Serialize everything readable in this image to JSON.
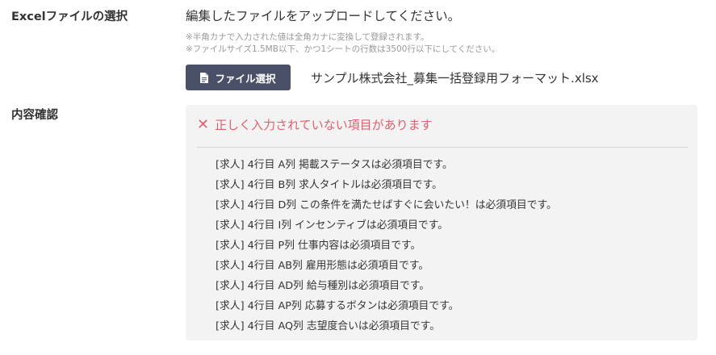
{
  "form": {
    "excel_label": "Excelファイルの選択",
    "instruction": "編集したファイルをアップロードしてください。",
    "note_1": "※半角カナで入力された値は全角カナに変換して登録されます。",
    "note_2": "※ファイルサイズ1.5MB以下、かつ1シートの行数は3500行以下にしてください。",
    "select_button_label": "ファイル選択",
    "select_button_icon": "document-icon",
    "file_name": "サンプル株式会社_募集一括登録用フォーマット.xlsx",
    "confirm_label": "内容確認"
  },
  "errors": {
    "header": "正しく入力されていない項目があります",
    "header_icon": "close-icon",
    "accent_color": "#e45f6d",
    "items": [
      "[求人] 4行目 A列 掲載ステータスは必須項目です。",
      "[求人] 4行目 B列 求人タイトルは必須項目です。",
      "[求人] 4行目 D列 この条件を満たせばすぐに会いたい！は必須項目です。",
      "[求人] 4行目 I列 インセンティブは必須項目です。",
      "[求人] 4行目 P列 仕事内容は必須項目です。",
      "[求人] 4行目 AB列 雇用形態は必須項目です。",
      "[求人] 4行目 AD列 給与種別は必須項目です。",
      "[求人] 4行目 AP列 応募するボタンは必須項目です。",
      "[求人] 4行目 AQ列 志望度合いは必須項目です。"
    ]
  }
}
